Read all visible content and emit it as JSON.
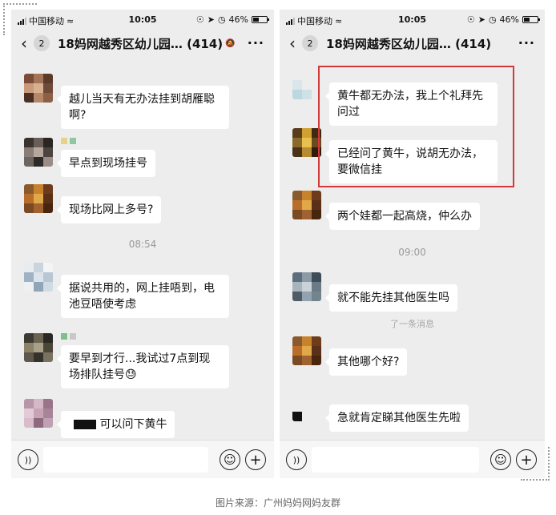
{
  "caption": "图片来源：广州妈妈网妈友群",
  "left": {
    "status": {
      "carrier": "中国移动",
      "time": "10:05",
      "battery": "46%",
      "battery_level": 0.46
    },
    "nav": {
      "back_badge": "2",
      "title": "18妈网越秀区幼儿园…",
      "count": "(414)"
    },
    "messages": [
      {
        "text": "越儿当天有无办法挂到胡雁聪啊?"
      },
      {
        "text": "早点到现场挂号"
      },
      {
        "text": "现场比网上多号?"
      },
      {
        "text": "据说共用的，网上挂唔到，电池豆唔使考虑"
      },
      {
        "text": "要早到才行...我试过7点到现场排队挂号😓"
      },
      {
        "text": "可以问下黄牛"
      }
    ],
    "timestamp": "08:54"
  },
  "right": {
    "status": {
      "carrier": "中国移动",
      "time": "10:05",
      "battery": "46%",
      "battery_level": 0.46
    },
    "nav": {
      "back_badge": "2",
      "title": "18妈网越秀区幼儿园…",
      "count": "(414)"
    },
    "messages": [
      {
        "text": "黄牛都无办法，我上个礼拜先问过"
      },
      {
        "text": "已经问了黄牛，说胡无办法，要微信挂"
      },
      {
        "text": "两个娃都一起高烧，仲么办"
      },
      {
        "text": "就不能先挂其他医生吗"
      },
      {
        "text": "其他哪个好?"
      },
      {
        "text": "急就肯定睇其他医生先啦"
      }
    ],
    "timestamp": "09:00",
    "system_note": "了一条消息"
  },
  "icons": {
    "back": "chevron-left-icon",
    "more": "more-icon",
    "voice": "voice-icon",
    "emoji": "emoji-icon",
    "plus": "plus-icon",
    "wifi": "wifi-icon",
    "mute": "mute-icon"
  },
  "colors": {
    "chat_bg": "#ededed",
    "bubble": "#ffffff",
    "highlight_border": "#d23a3a"
  }
}
